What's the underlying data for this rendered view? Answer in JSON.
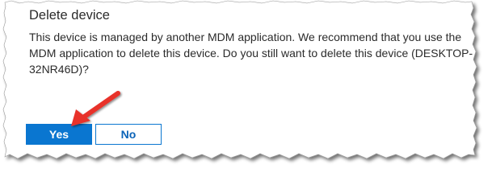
{
  "dialog": {
    "title": "Delete device",
    "message": "This device is managed by another MDM application. We recommend that you use the MDM application to delete this device. Do you still want to delete this device (DESKTOP-32NR46D)?",
    "buttons": {
      "yes_label": "Yes",
      "no_label": "No"
    }
  },
  "colors": {
    "primary_button": "#0a76d0",
    "annotation_arrow": "#e8302a",
    "text": "#2b2b2b"
  },
  "icons": {
    "annotation": "red-arrow-icon"
  }
}
